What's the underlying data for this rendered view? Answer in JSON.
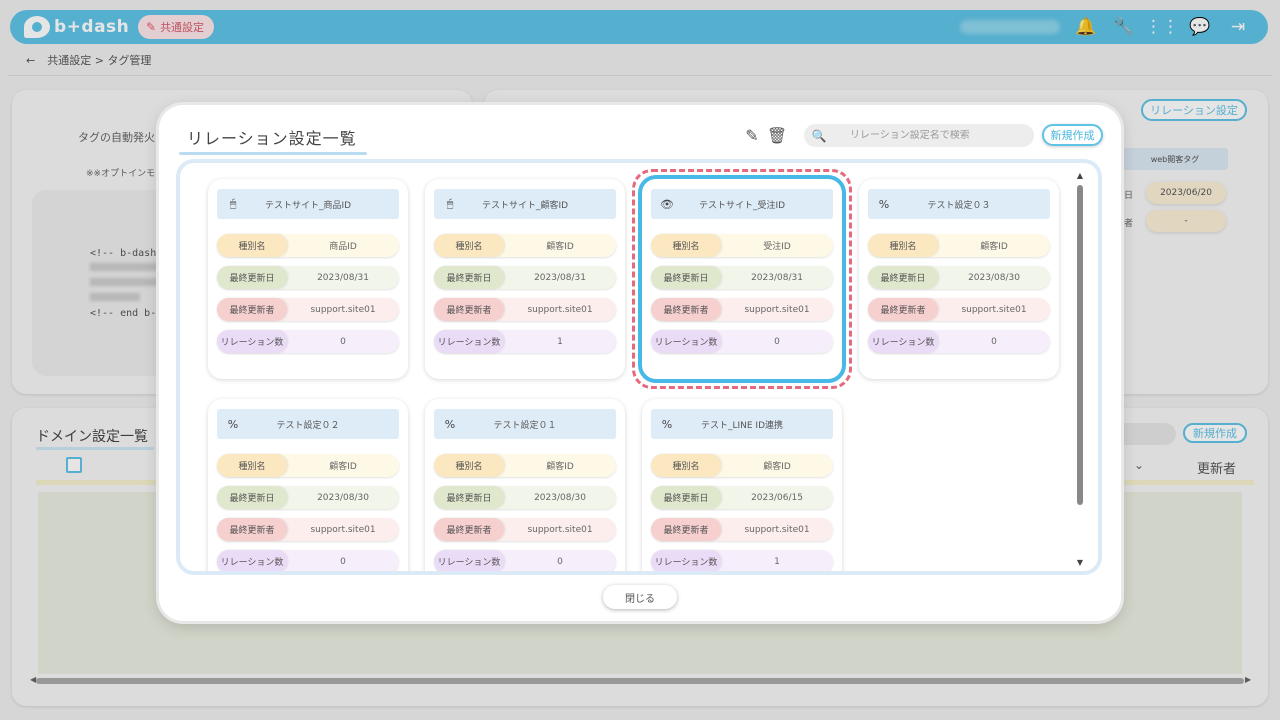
{
  "app": {
    "logo_text": "b+dash",
    "env_label": "共通設定",
    "icons": [
      "bell-icon",
      "wrench-icon",
      "grid-icon",
      "help-chat-icon",
      "logout-icon"
    ]
  },
  "breadcrumb": {
    "back": "←",
    "path": "共通設定 > タグ管理"
  },
  "background": {
    "auto_fire_text": "タグの自動発火を",
    "option_text": "※※オプトインモ",
    "code_line1": "<!-- b-dash t",
    "code_line4": "<!-- end b-da",
    "relation_button": "リレーション設定",
    "web_tag_header": "web閲客タグ",
    "web_tag_date": "2023/06/20",
    "web_tag_day_label": "日",
    "web_tag_user_label": "者",
    "web_tag_dash": "-",
    "domain_title": "ドメイン設定一覧",
    "domain_new_button": "新規作成",
    "updater_header": "更新者"
  },
  "modal": {
    "title": "リレーション設定一覧",
    "search_placeholder": "リレーション設定名で検索",
    "new_button": "新規作成",
    "close_button": "閉じる",
    "labels": {
      "type": "種別名",
      "updated_date": "最終更新日",
      "updated_by": "最終更新者",
      "relation_count": "リレーション数"
    },
    "cards": [
      {
        "name": "テストサイト_商品ID",
        "icon": "mouse-icon",
        "icon_glyph": "🖱",
        "type": "商品ID",
        "updated_date": "2023/08/31",
        "updated_by": "support.site01",
        "relation_count": "0"
      },
      {
        "name": "テストサイト_顧客ID",
        "icon": "mouse-icon",
        "icon_glyph": "🖱",
        "type": "顧客ID",
        "updated_date": "2023/08/31",
        "updated_by": "support.site01",
        "relation_count": "1"
      },
      {
        "name": "テストサイト_受注ID",
        "icon": "eye-icon",
        "icon_glyph": "👁",
        "type": "受注ID",
        "updated_date": "2023/08/31",
        "updated_by": "support.site01",
        "relation_count": "0",
        "selected": true
      },
      {
        "name": "テスト設定０３",
        "icon": "percent-icon",
        "icon_glyph": "%",
        "type": "顧客ID",
        "updated_date": "2023/08/30",
        "updated_by": "support.site01",
        "relation_count": "0"
      },
      {
        "name": "テスト設定０２",
        "icon": "percent-icon",
        "icon_glyph": "%",
        "type": "顧客ID",
        "updated_date": "2023/08/30",
        "updated_by": "support.site01",
        "relation_count": "0"
      },
      {
        "name": "テスト設定０１",
        "icon": "percent-icon",
        "icon_glyph": "%",
        "type": "顧客ID",
        "updated_date": "2023/08/30",
        "updated_by": "support.site01",
        "relation_count": "0"
      },
      {
        "name": "テスト_LINE ID連携",
        "icon": "percent-icon",
        "icon_glyph": "%",
        "type": "顧客ID",
        "updated_date": "2023/06/15",
        "updated_by": "support.site01",
        "relation_count": "1"
      }
    ]
  },
  "colors": {
    "brand": "#5fc3e6",
    "selected_outline": "#47b9e6",
    "highlight_dashed": "#e56a7d"
  }
}
